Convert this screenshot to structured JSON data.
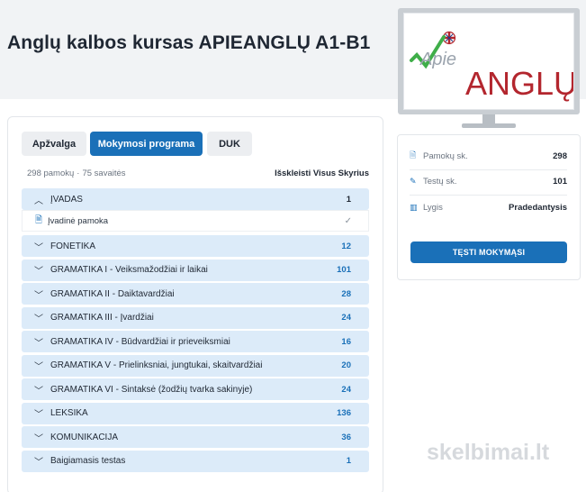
{
  "page": {
    "title": "Anglų kalbos kursas APIEANGLŲ A1-B1"
  },
  "logo": {
    "small_text": "Apie",
    "large_text": "ANGLŲ"
  },
  "tabs": [
    {
      "label": "Apžvalga"
    },
    {
      "label": "Mokymosi programa"
    },
    {
      "label": "DUK"
    }
  ],
  "meta": {
    "lessons": "298 pamokų",
    "weeks": "75 savaitės",
    "expand_all": "Išskleisti Visus Skyrius"
  },
  "sections": [
    {
      "title": "ĮVADAS",
      "count": "1",
      "expanded": true
    },
    {
      "title": "FONETIKA",
      "count": "12"
    },
    {
      "title": "GRAMATIKA I - Veiksmažodžiai ir laikai",
      "count": "101"
    },
    {
      "title": "GRAMATIKA II - Daiktavardžiai",
      "count": "28"
    },
    {
      "title": "GRAMATIKA III - Įvardžiai",
      "count": "24"
    },
    {
      "title": "GRAMATIKA IV - Būdvardžiai ir prieveiksmiai",
      "count": "16"
    },
    {
      "title": "GRAMATIKA V - Prielinksniai, jungtukai, skaitvardžiai",
      "count": "20"
    },
    {
      "title": "GRAMATIKA VI - Sintaksė (žodžių tvarka sakinyje)",
      "count": "24"
    },
    {
      "title": "LEKSIKA",
      "count": "136"
    },
    {
      "title": "KOMUNIKACIJA",
      "count": "36"
    },
    {
      "title": "Baigiamasis testas",
      "count": "1"
    }
  ],
  "lesson": {
    "title": "Įvadinė pamoka"
  },
  "info": {
    "lessons_label": "Pamokų sk.",
    "lessons_value": "298",
    "tests_label": "Testų sk.",
    "tests_value": "101",
    "level_label": "Lygis",
    "level_value": "Pradedantysis",
    "cta": "TĘSTI MOKYMĄSI"
  },
  "watermark": {
    "text": "skelbimai.lt"
  },
  "colors": {
    "accent": "#1a70b8",
    "section_bg": "#dcebf9",
    "logo_red": "#b3262e",
    "logo_green": "#3fae49"
  }
}
